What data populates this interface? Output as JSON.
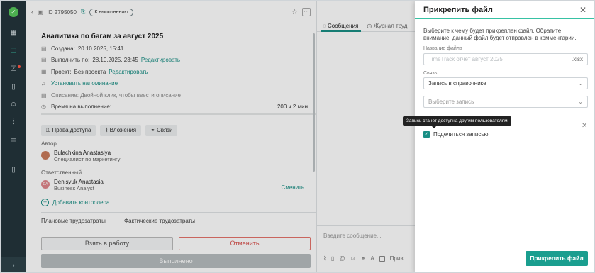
{
  "rail": {
    "logo_icon": "check-circle-icon",
    "items": [
      "grid-icon",
      "layers-icon",
      "task-icon",
      "document-icon",
      "users-icon",
      "chart-icon",
      "folder-icon",
      "mobile-icon"
    ],
    "collapse": "›"
  },
  "task": {
    "id": "ID 2795050",
    "status": "К выполнению",
    "title": "Аналитика по багам за август 2025",
    "created_label": "Создана:",
    "created_value": "20.10.2025, 15:41",
    "due_label": "Выполнить по:",
    "due_value": "28.10.2025, 23:45",
    "edit_link": "Редактировать",
    "project_label": "Проект:",
    "project_value": "Без проекта",
    "project_edit": "Редактировать",
    "reminder": "Установить напоминание",
    "description": "Описание: Двойной клик, чтобы ввести описание",
    "time_label": "Время на выполнение:",
    "time_value": "200 ч 2 мин",
    "tabs": [
      "Права доступа",
      "Вложения",
      "Связи"
    ],
    "author_label": "Автор",
    "author_name": "Bulachkina Anastasiya",
    "author_role": "Специалист по маркетингу",
    "responsible_label": "Ответственный",
    "responsible_name": "Denisyuk Anastasia",
    "responsible_role": "Business Analyst",
    "responsible_initials": "DA",
    "change_link": "Сменить",
    "add_controller": "Добавить контролера",
    "planned_effort": "Плановые трудозатраты",
    "actual_effort": "Фактические трудозатраты",
    "btn_take": "Взять в работу",
    "btn_cancel": "Отменить",
    "btn_done": "Выполнено"
  },
  "messages": {
    "tab_messages": "Сообщения",
    "tab_journal": "Журнал труд",
    "placeholder": "Введите сообщение...",
    "private_label": "Прив"
  },
  "modal": {
    "title": "Прикрепить файл",
    "description": "Выберите к чему будет прикреплен файл. Обратите внимание, данный файл будет отправлен в комментарии.",
    "filename_label": "Название файла",
    "filename_placeholder": "TimeTrack отчет август 2025",
    "filename_ext": ".xlsx",
    "link_label": "Связь",
    "link_value": "Запись в справочнике",
    "record_placeholder": "Выберите запись",
    "tooltip": "Запись станет доступна другим пользователям",
    "share_label": "Поделиться записью",
    "submit": "Прикрепить файл"
  },
  "colors": {
    "accent": "#1a9e8f",
    "rail": "#1f2e34",
    "danger": "#d9534f"
  }
}
